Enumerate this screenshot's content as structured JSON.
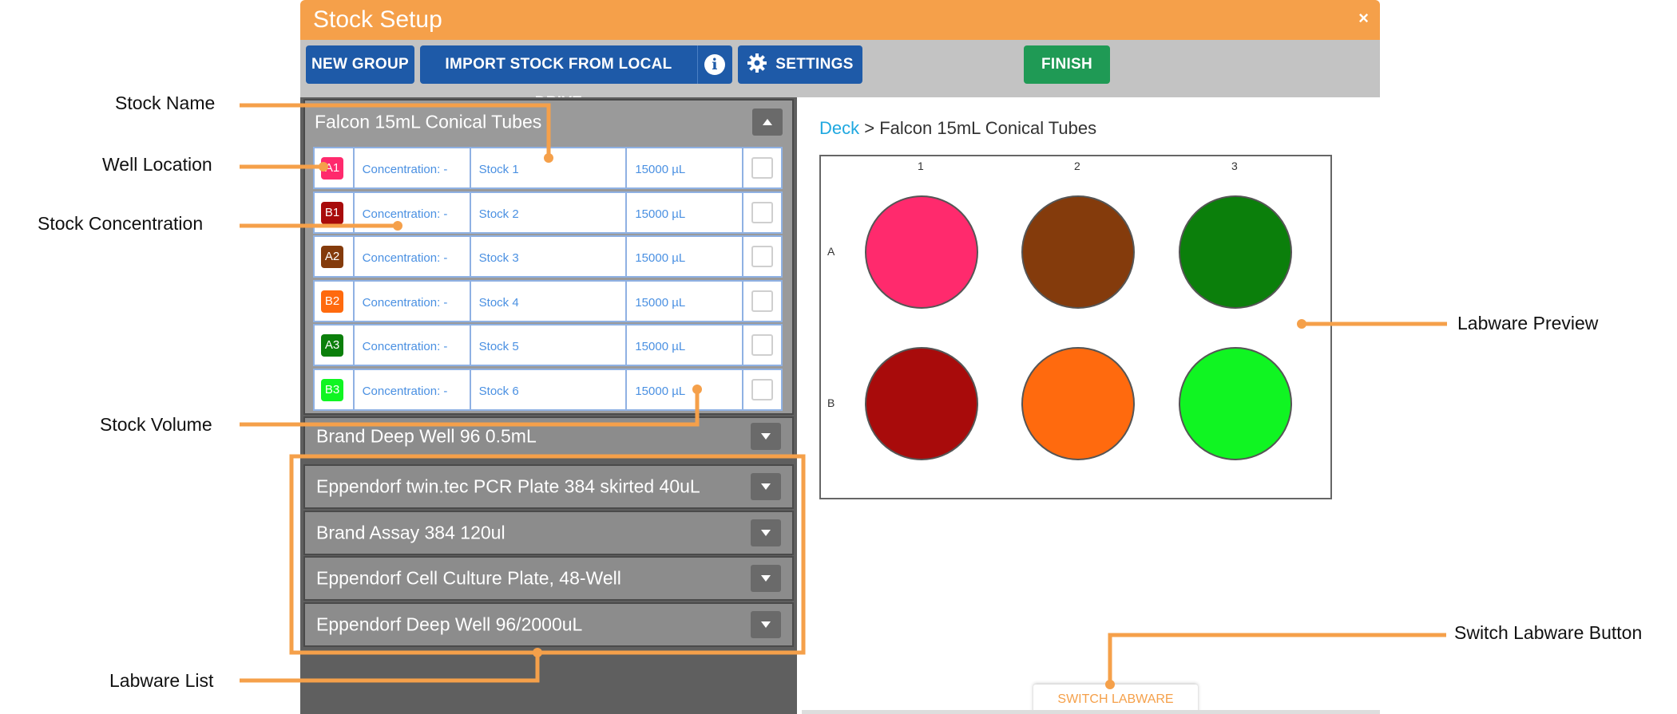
{
  "window": {
    "title": "Stock Setup",
    "close_glyph": "×"
  },
  "toolbar": {
    "new_group": "NEW GROUP",
    "import_stock": "IMPORT STOCK FROM LOCAL DRIVE",
    "info_glyph": "i",
    "settings": "SETTINGS",
    "finish": "FINISH"
  },
  "expanded_group": {
    "name": "Falcon 15mL Conical Tubes",
    "rows": [
      {
        "well": "A1",
        "color": "#ff2a6d",
        "concentration": "Concentration: -",
        "stock": "Stock 1",
        "volume": "15000 µL"
      },
      {
        "well": "B1",
        "color": "#a80b0b",
        "concentration": "Concentration: -",
        "stock": "Stock 2",
        "volume": "15000 µL"
      },
      {
        "well": "A2",
        "color": "#843b0c",
        "concentration": "Concentration: -",
        "stock": "Stock 3",
        "volume": "15000 µL"
      },
      {
        "well": "B2",
        "color": "#ff6a0e",
        "concentration": "Concentration: -",
        "stock": "Stock 4",
        "volume": "15000 µL"
      },
      {
        "well": "A3",
        "color": "#0b7f0b",
        "concentration": "Concentration: -",
        "stock": "Stock 5",
        "volume": "15000 µL"
      },
      {
        "well": "B3",
        "color": "#10f522",
        "concentration": "Concentration: -",
        "stock": "Stock 6",
        "volume": "15000 µL"
      }
    ]
  },
  "labware_groups": [
    "Brand Deep Well 96 0.5mL",
    "Eppendorf twin.tec PCR Plate 384 skirted 40uL",
    "Brand Assay 384 120ul",
    "Eppendorf Cell Culture Plate, 48-Well",
    "Eppendorf Deep Well 96/2000uL"
  ],
  "breadcrumb": {
    "root": "Deck",
    "separator": ">",
    "current": "Falcon 15mL Conical Tubes"
  },
  "preview": {
    "columns": [
      "1",
      "2",
      "3"
    ],
    "rows": [
      "A",
      "B"
    ],
    "well_colors": [
      [
        "#ff2a6d",
        "#843b0c",
        "#0b7f0b"
      ],
      [
        "#a80b0b",
        "#ff6a0e",
        "#10f522"
      ]
    ]
  },
  "switch_labware": "SWITCH LABWARE",
  "annotations": {
    "stock_name": "Stock Name",
    "well_location": "Well Location",
    "stock_concentration": "Stock Concentration",
    "stock_volume": "Stock Volume",
    "labware_list": "Labware List",
    "labware_preview": "Labware Preview",
    "switch_labware_button": "Switch Labware Button"
  },
  "colors": {
    "accent": "#f5a04a",
    "primary_button": "#1e5aa8",
    "finish_button": "#1f9a55",
    "link": "#1fa8e0"
  }
}
